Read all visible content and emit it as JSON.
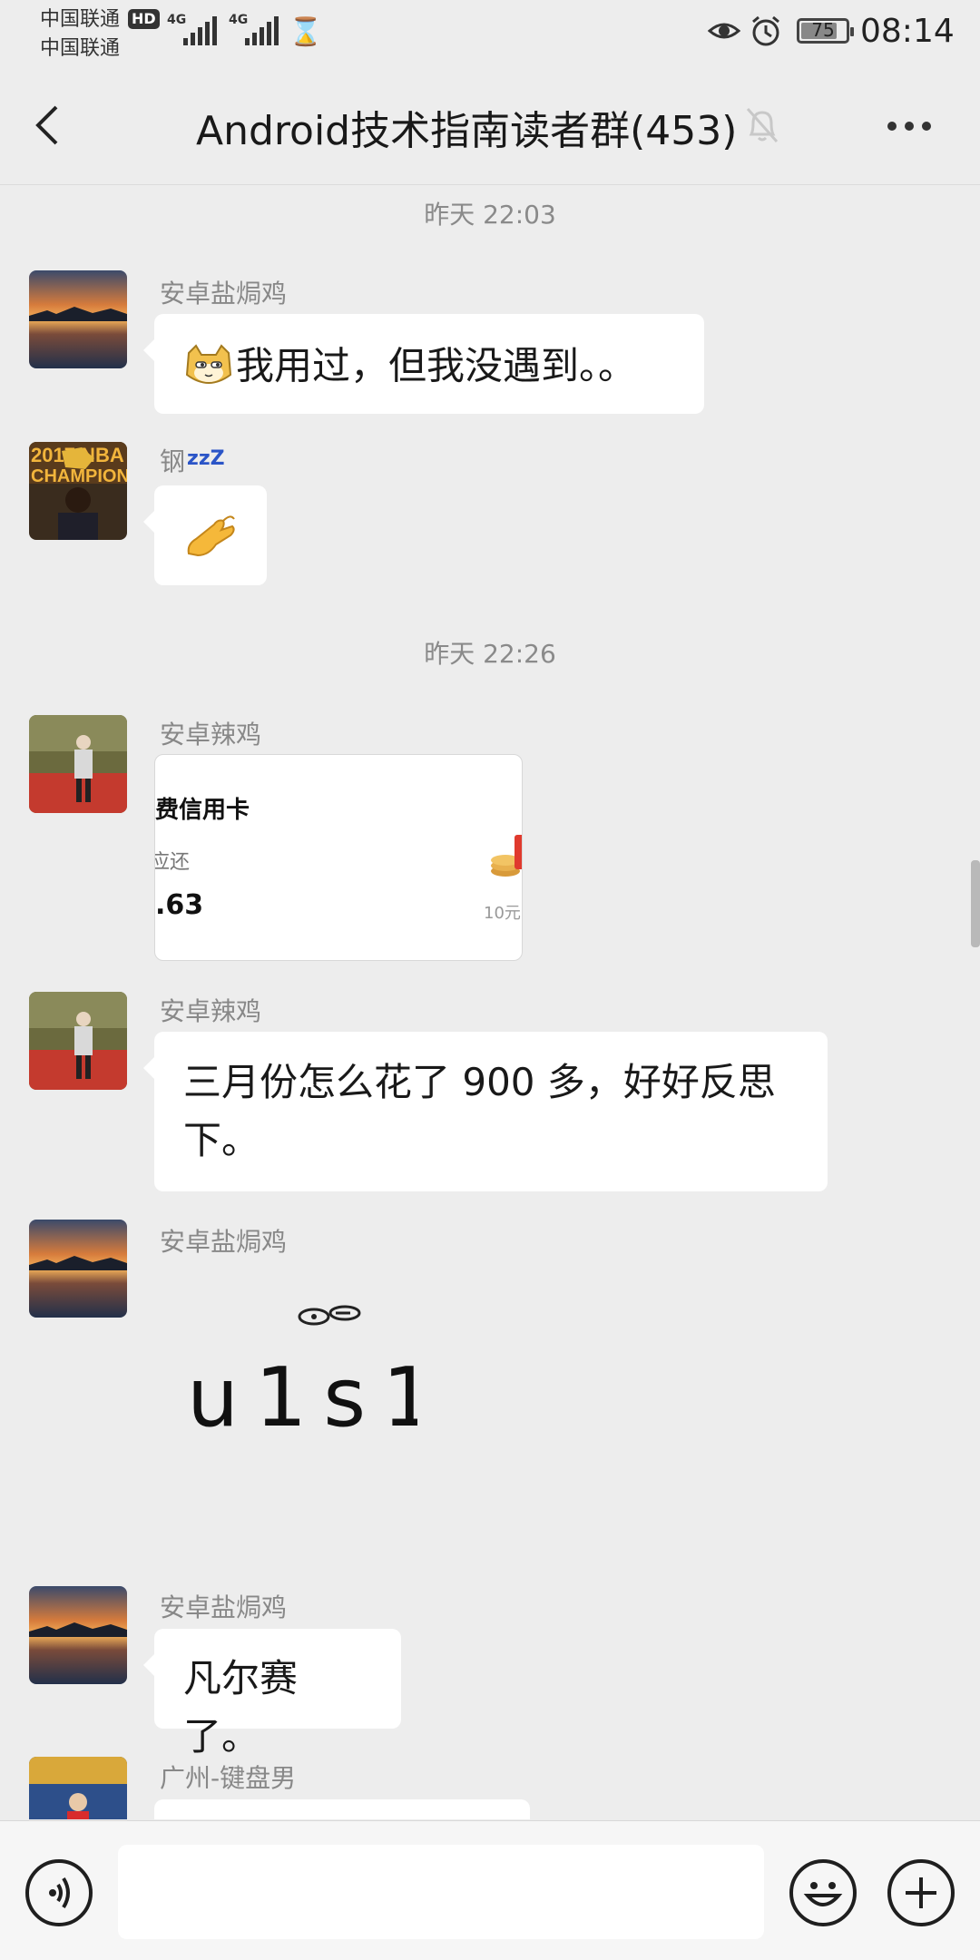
{
  "status_bar": {
    "carrier1": "中国联通",
    "carrier2": "中国联通",
    "hd_badge": "HD",
    "signal1_label": "4G",
    "signal2_label": "4G",
    "battery": "75",
    "time": "08:14",
    "icons": [
      "eye-icon",
      "alarm-icon",
      "hourglass-icon"
    ]
  },
  "header": {
    "title": "Android技术指南读者群(453)",
    "icons": [
      "back-arrow-icon",
      "muted-bell-icon",
      "more-icon"
    ]
  },
  "messages": [
    {
      "type": "timestamp",
      "text": "昨天 22:03"
    },
    {
      "type": "text",
      "sender": "安卓盐焗鸡",
      "emoji": "cat-face-emoji",
      "text": "我用过，但我没遇到。。"
    },
    {
      "type": "emoji",
      "sender": "钢",
      "sender_suffix": "zzZ",
      "emoji": "pinching-hand-emoji"
    },
    {
      "type": "timestamp",
      "text": "昨天 22:26"
    },
    {
      "type": "card",
      "sender": "安卓辣鸡",
      "card": {
        "title": "费信用卡",
        "label": "应还",
        "amount": ".63",
        "reward": "10元"
      }
    },
    {
      "type": "text",
      "sender": "安卓辣鸡",
      "text_line1": "三月份怎么花了 900 多，好好反思",
      "text_line2": "下。"
    },
    {
      "type": "sticker",
      "sender": "安卓盐焗鸡",
      "sticker_text": "u1s1"
    },
    {
      "type": "text",
      "sender": "安卓盐焗鸡",
      "text": "凡尔赛了。"
    },
    {
      "type": "text",
      "sender": "广州-键盘男",
      "text": ""
    }
  ],
  "input_bar": {
    "value": "",
    "icons": [
      "voice-icon",
      "emoji-icon",
      "plus-icon"
    ]
  }
}
